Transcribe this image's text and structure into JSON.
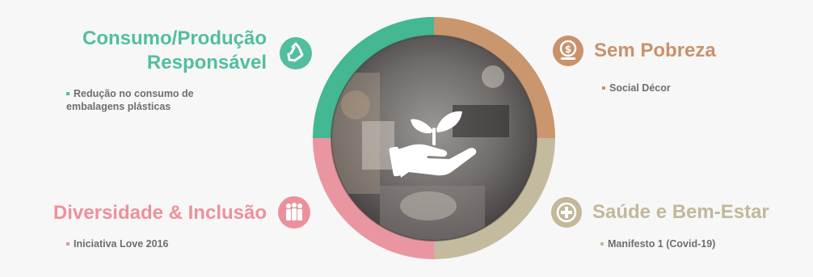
{
  "colors": {
    "green": "#52bea0",
    "orange": "#c9926b",
    "pink": "#ec919c",
    "beige": "#c2b89a",
    "ring_green": "#44b793",
    "ring_orange": "#c9966e",
    "ring_pink": "#e996a1",
    "ring_beige": "#c4bb9f"
  },
  "center": {
    "icon": "hand-plant-icon"
  },
  "quadrants": {
    "consumo": {
      "title_line1": "Consumo/Produção",
      "title_line2": "Responsável",
      "icon": "recycle-icon",
      "items": [
        "Redução no consumo de embalagens plásticas"
      ]
    },
    "pobreza": {
      "title": "Sem Pobreza",
      "icon": "coin-stack-icon",
      "items": [
        "Social Décor"
      ]
    },
    "diversidade": {
      "title": "Diversidade & Inclusão",
      "icon": "people-icon",
      "items": [
        "Iniciativa Love 2016"
      ]
    },
    "saude": {
      "title": "Saúde e Bem-Estar",
      "icon": "health-plus-icon",
      "items": [
        "Manifesto 1 (Covid-19)"
      ]
    }
  }
}
